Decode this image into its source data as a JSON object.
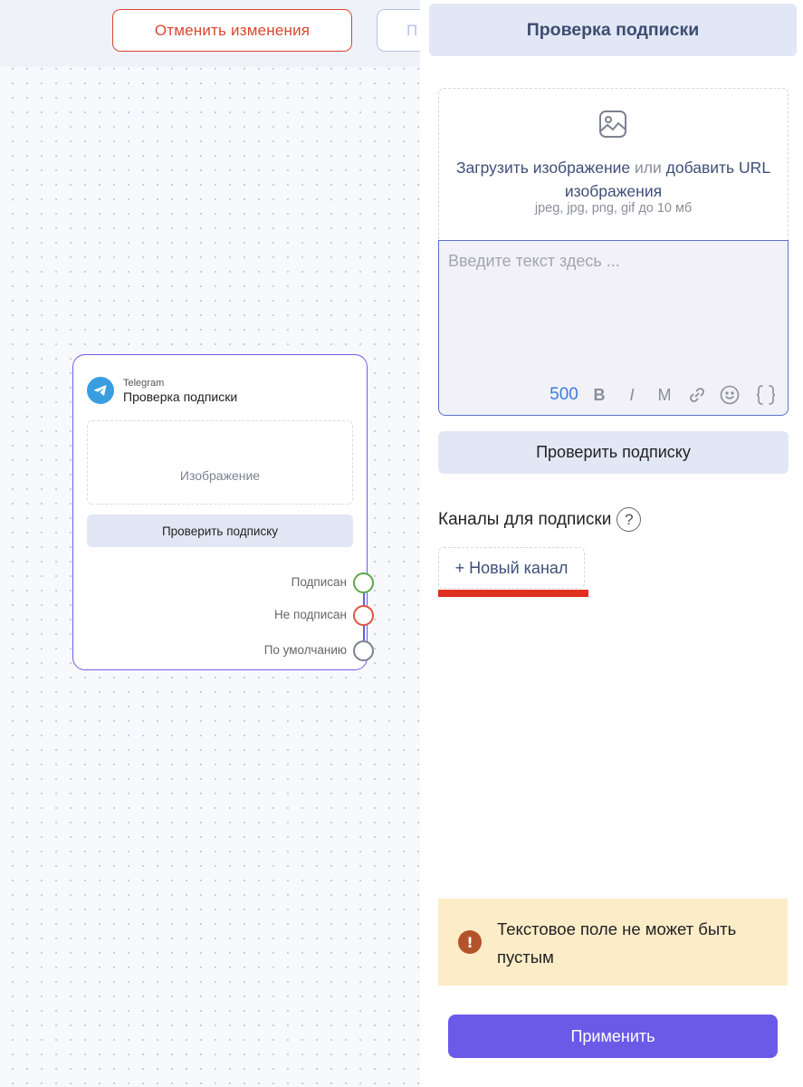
{
  "toolbar": {
    "cancel_label": "Отменить изменения",
    "second_label": "П"
  },
  "node": {
    "platform": "Telegram",
    "title": "Проверка подписки",
    "image_placeholder": "Изображение",
    "check_button": "Проверить подписку",
    "ports": [
      {
        "label": "Подписан",
        "color": "#5aa845"
      },
      {
        "label": "Не подписан",
        "color": "#e0533f"
      },
      {
        "label": "По умолчанию",
        "color": "#7d8290"
      }
    ]
  },
  "panel": {
    "title": "Проверка подписки",
    "upload": {
      "link1": "Загрузить изображение",
      "connector": "или",
      "link2": "добавить URL изображения",
      "hint": "jpeg, jpg, png, gif до 10 мб"
    },
    "editor": {
      "placeholder": "Введите текст здесь ...",
      "char_count": "500",
      "tools": [
        "B",
        "I",
        "M"
      ]
    },
    "check_button": "Проверить подписку",
    "channels_label": "Каналы для подписки",
    "help_symbol": "?",
    "new_channel_button": "+ Новый канал",
    "error": {
      "icon": "!",
      "text": "Текстовое поле не может быть пустым"
    },
    "apply_button": "Применить"
  },
  "colors": {
    "accent": "#6b5ae8",
    "danger": "#d9462f",
    "header_bg": "#e2e7f6",
    "warning_bg": "#fcecc8"
  }
}
